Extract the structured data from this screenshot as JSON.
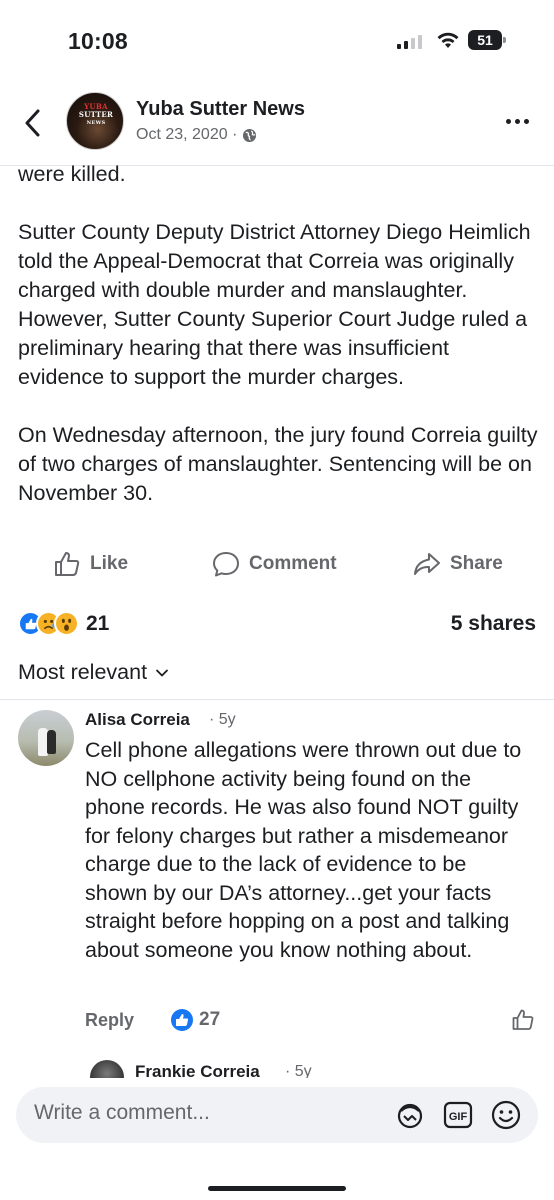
{
  "status_bar": {
    "time": "10:08",
    "battery": "51"
  },
  "header": {
    "page_name": "Yuba Sutter News",
    "date": "Oct 23, 2020 ·",
    "avatar_text_top": "YUBA",
    "avatar_text_bottom": "SUTTER",
    "avatar_text_small": "NEWS",
    "icons": {
      "back": "chevron-left-icon",
      "privacy": "globe-icon",
      "more": "more-horizontal-icon"
    }
  },
  "post": {
    "paragraphs": [
      "were killed.",
      "Sutter County Deputy District Attorney Diego Heimlich told the Appeal-Democrat that Correia was originally charged with double murder and manslaughter. However, Sutter County Superior Court Judge ruled a preliminary hearing that there was insufficient evidence to support the murder charges.",
      "On Wednesday afternoon, the jury found Correia guilty of two charges of manslaughter. Sentencing will be on November 30."
    ]
  },
  "actions": {
    "like": "Like",
    "comment": "Comment",
    "share": "Share"
  },
  "engagement": {
    "reactions": [
      "like",
      "sad",
      "wow"
    ],
    "reaction_count": "21",
    "shares": "5 shares"
  },
  "comments_sort": {
    "label": "Most relevant"
  },
  "comments": [
    {
      "author": "Alisa Correia",
      "age": "· 5y",
      "text": "Cell phone allegations were thrown out due to NO cellphone activity being found on the phone records. He was also found NOT guilty for felony charges but rather a misdemeanor charge due to the lack of evidence to be shown by our DA’s attorney...get your facts straight before hopping on a post and talking about someone you know nothing about.",
      "reply_label": "Reply",
      "like_count": "27"
    }
  ],
  "reply_preview": {
    "author": "Frankie Correia",
    "age": "· 5y"
  },
  "composer": {
    "placeholder": "Write a comment...",
    "icons": [
      "avatar-sticker-icon",
      "gif-icon",
      "emoji-icon"
    ]
  },
  "colors": {
    "accent": "#1877f2",
    "secondary_text": "#65676b",
    "composer_bg": "#f0f2f5"
  }
}
